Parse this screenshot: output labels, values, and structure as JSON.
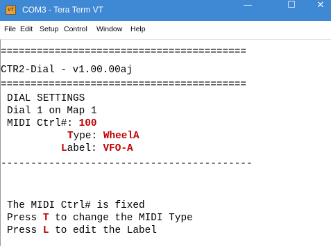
{
  "window": {
    "title": "COM3 - Tera Term VT",
    "icon_label": "VT",
    "minimize_glyph": "—",
    "maximize_glyph": "☐",
    "close_glyph": "✕"
  },
  "menu": [
    "File",
    "Edit",
    "Setup",
    "Control",
    "Window",
    "Help"
  ],
  "terminal": {
    "separator_double": "=========================================",
    "heading": "CTR2-Dial - v1.00.00aj",
    "section_title": "DIAL SETTINGS",
    "dial_info": "Dial 1 on Map 1",
    "midi_ctrl_label": "MIDI Ctrl#: ",
    "midi_ctrl_value": "100",
    "type_hotkey": "T",
    "type_rest": "ype: ",
    "type_value": "WheelA",
    "label_hotkey": "L",
    "label_rest": "abel: ",
    "label_value": "VFO-A",
    "separator_dashed": "------------------------------------------",
    "msg_fixed": "The MIDI Ctrl# is fixed",
    "press1_prefix": "Press ",
    "press1_key": "T",
    "press1_suffix": " to change the MIDI Type",
    "press2_prefix": "Press ",
    "press2_key": "L",
    "press2_suffix": " to edit the Label"
  },
  "colors": {
    "titlebar": "#3f88d4",
    "highlight": "#c00000"
  }
}
